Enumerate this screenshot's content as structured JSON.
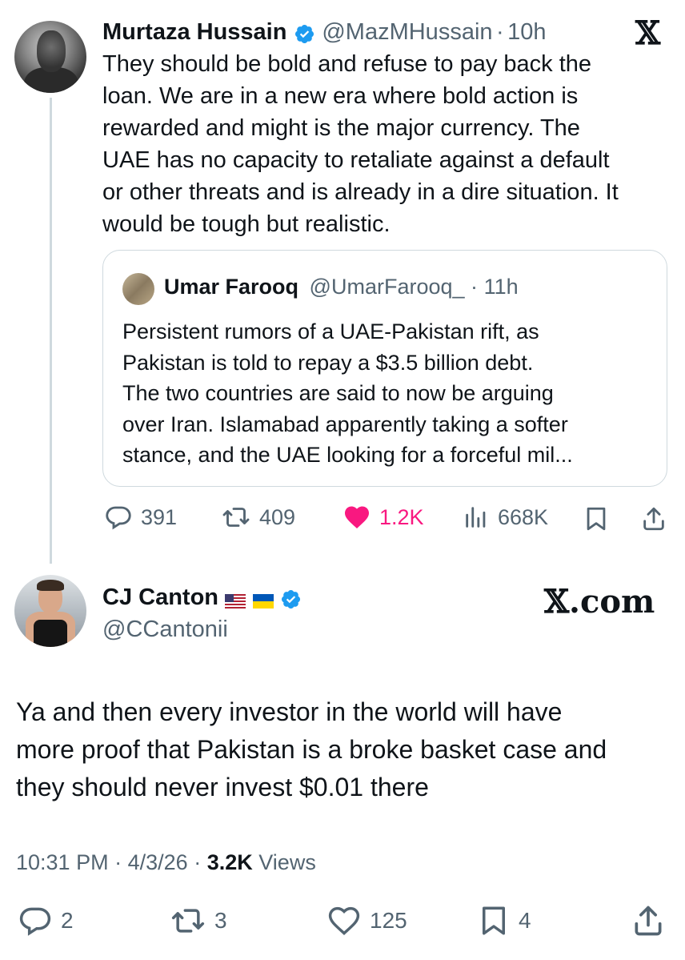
{
  "top_tweet": {
    "name": "Murtaza Hussain",
    "handle": "@MazMHussain",
    "dot": "·",
    "time": "10h",
    "x_logo": "𝕏",
    "lines": [
      "They should be bold and refuse to pay back the",
      "loan. We are in a new era where bold action is",
      "rewarded and might is the major currency. The",
      "UAE has no capacity to retaliate against a default",
      "or other threats and is already in a dire situation. It",
      "would be tough but realistic."
    ],
    "quote": {
      "name": "Umar Farooq",
      "handle": "@UmarFarooq_",
      "dot": "·",
      "time": "11h",
      "lines": [
        "Persistent rumors of a UAE-Pakistan rift, as",
        "Pakistan is told to repay a $3.5 billion debt.",
        "The two countries are said to now be arguing",
        "over Iran. Islamabad apparently taking a softer",
        "stance, and the UAE looking for a forceful mil..."
      ]
    },
    "actions": {
      "replies": "391",
      "reposts": "409",
      "likes": "1.2K",
      "views": "668K"
    },
    "colors": {
      "like": "#f91880",
      "verified": "#1d9bf0"
    }
  },
  "reply_tweet": {
    "name": "CJ Canton",
    "handle": "@CCantonii",
    "flags": [
      "us-flag",
      "ukraine-flag"
    ],
    "brand": "𝕏.com",
    "lines": [
      "Ya and then every investor in the world will have",
      "more proof that Pakistan is a broke basket case and",
      "they should never invest $0.01 there"
    ],
    "meta": {
      "time": "10:31 PM",
      "sep1": "·",
      "date": "4/3/26",
      "sep2": "·",
      "views_count": "3.2K",
      "views_label": "Views"
    },
    "actions": {
      "replies": "2",
      "reposts": "3",
      "likes": "125",
      "bookmarks": "4"
    }
  }
}
